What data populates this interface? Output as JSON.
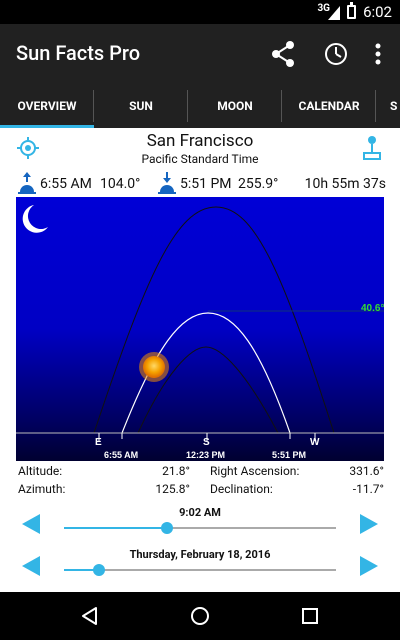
{
  "status": {
    "network": "3G",
    "time": "6:02"
  },
  "appbar": {
    "title": "Sun Facts Pro"
  },
  "tabs": [
    {
      "label": "OVERVIEW",
      "active": true
    },
    {
      "label": "SUN",
      "active": false
    },
    {
      "label": "MOON",
      "active": false
    },
    {
      "label": "CALENDAR",
      "active": false
    },
    {
      "label": "S",
      "active": false
    }
  ],
  "location": {
    "city": "San Francisco",
    "timezone": "Pacific Standard Time"
  },
  "sunrise": {
    "time": "6:55 AM",
    "azimuth": "104.0°"
  },
  "sunset": {
    "time": "5:51 PM",
    "azimuth": "255.9°"
  },
  "daylength": "10h 55m 37s",
  "sky": {
    "max_altitude_label": "40.6°",
    "axis": {
      "east": "E",
      "south": "S",
      "west": "W",
      "rise_time": "6:55 AM",
      "noon_time": "12:23 PM",
      "set_time": "5:51 PM"
    }
  },
  "details": {
    "altitude_label": "Altitude:",
    "altitude_value": "21.8°",
    "azimuth_label": "Azimuth:",
    "azimuth_value": "125.8°",
    "ra_label": "Right Ascension:",
    "ra_value": "331.6°",
    "dec_label": "Declination:",
    "dec_value": "-11.7°"
  },
  "time_control": {
    "label": "9:02 AM",
    "level": 0.38
  },
  "date_control": {
    "label": "Thursday, February 18, 2016",
    "level": 0.13
  }
}
